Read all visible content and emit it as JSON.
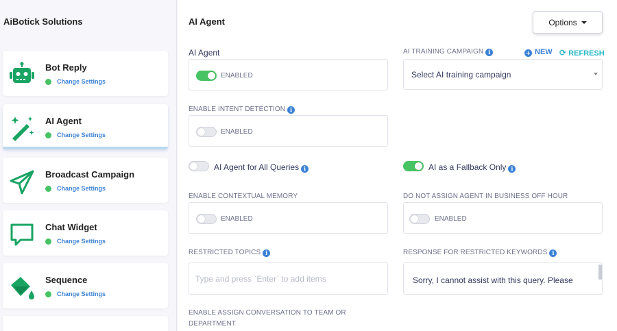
{
  "sidebar": {
    "brand": "AiBotick Solutions",
    "items": [
      {
        "title": "Bot Reply",
        "link": "Change Settings",
        "icon": "robot-icon"
      },
      {
        "title": "AI Agent",
        "link": "Change Settings",
        "icon": "magic-wand-icon"
      },
      {
        "title": "Broadcast Campaign",
        "link": "Change Settings",
        "icon": "paper-plane-icon"
      },
      {
        "title": "Chat Widget",
        "link": "Change Settings",
        "icon": "chat-bubble-icon"
      },
      {
        "title": "Sequence",
        "link": "Change Settings",
        "icon": "paint-bucket-icon"
      }
    ]
  },
  "main": {
    "title": "AI Agent",
    "options_label": "Options",
    "ai_agent": {
      "label": "AI Agent",
      "toggle_label": "ENABLED",
      "on": true
    },
    "training": {
      "label": "AI TRAINING CAMPAIGN",
      "new_label": "NEW",
      "refresh_label": "REFRESH",
      "selected": "Select AI training campaign"
    },
    "intent": {
      "label": "ENABLE INTENT DETECTION",
      "toggle_label": "ENABLED",
      "on": false
    },
    "all_queries": {
      "label": "AI Agent for All Queries",
      "on": false
    },
    "fallback": {
      "label": "AI as a Fallback Only",
      "on": true
    },
    "contextual": {
      "label": "ENABLE CONTEXTUAL MEMORY",
      "toggle_label": "ENABLED",
      "on": false
    },
    "off_hour": {
      "label": "DO NOT ASSIGN AGENT IN BUSINESS OFF HOUR",
      "toggle_label": "ENABLED",
      "on": false
    },
    "restricted_topics": {
      "label": "RESTRICTED TOPICS",
      "placeholder": "Type and press `Enter` to add items"
    },
    "restricted_response": {
      "label": "RESPONSE FOR RESTRICTED KEYWORDS",
      "value": "Sorry, I cannot assist with this query. Please"
    },
    "assign_conversation": {
      "label_line1": "ENABLE ASSIGN CONVERSATION TO TEAM OR",
      "label_line2": "DEPARTMENT"
    }
  },
  "colors": {
    "accent_green": "#47c363",
    "link_blue": "#3b82d6",
    "icon_green": "#19a463",
    "refresh_teal": "#2bb9c8"
  }
}
